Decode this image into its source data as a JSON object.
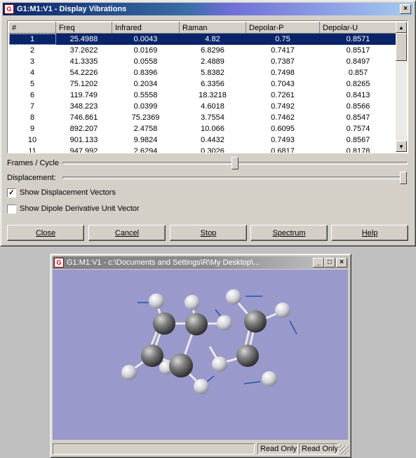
{
  "dialog": {
    "title": "G1:M1:V1 - Display Vibrations",
    "close_glyph": "×",
    "table": {
      "columns": [
        "#",
        "Freq",
        "Infrared",
        "Raman",
        "Depolar-P",
        "Depolar-U"
      ],
      "rows": [
        [
          "1",
          "25.4988",
          "0.0043",
          "4.82",
          "0.75",
          "0.8571"
        ],
        [
          "2",
          "37.2622",
          "0.0169",
          "6.8296",
          "0.7417",
          "0.8517"
        ],
        [
          "3",
          "41.3335",
          "0.0558",
          "2.4889",
          "0.7387",
          "0.8497"
        ],
        [
          "4",
          "54.2226",
          "0.8396",
          "5.8382",
          "0.7498",
          "0.857"
        ],
        [
          "5",
          "75.1202",
          "0.2034",
          "6.3356",
          "0.7043",
          "0.8265"
        ],
        [
          "6",
          "119.749",
          "0.5558",
          "18.3218",
          "0.7261",
          "0.8413"
        ],
        [
          "7",
          "348.223",
          "0.0399",
          "4.6018",
          "0.7492",
          "0.8566"
        ],
        [
          "8",
          "746.861",
          "75.2369",
          "3.7554",
          "0.7462",
          "0.8547"
        ],
        [
          "9",
          "892.207",
          "2.4758",
          "10.066",
          "0.6095",
          "0.7574"
        ],
        [
          "10",
          "901.133",
          "9.9824",
          "0.4432",
          "0.7493",
          "0.8567"
        ],
        [
          "11",
          "947.992",
          "2.6294",
          "0.3026",
          "0.6817",
          "0.8178"
        ]
      ],
      "selected_row": 1
    },
    "frames_cycle_label": "Frames / Cycle",
    "displacement_label": "Displacement:",
    "show_displacement_vectors": {
      "label": "Show Displacement Vectors",
      "checked": true
    },
    "show_dipole_derivative": {
      "label": "Show Dipole Derivative Unit Vector",
      "checked": false
    },
    "buttons": {
      "close": "Close",
      "cancel": "Cancel",
      "stop": "Stop",
      "spectrum": "Spectrum",
      "help": "Help"
    }
  },
  "viewer": {
    "title": "G1:M1:V1 - c:\\Documents and Settings\\R\\My Desktop\\...",
    "minimize_glyph": "_",
    "maximize_glyph": "□",
    "close_glyph": "×",
    "status_readonly_1": "Read Only",
    "status_readonly_2": "Read Only",
    "background_color": "#9999cc"
  },
  "colors": {
    "title_gradient_start": "#0a246a",
    "title_gradient_end": "#a6caf0",
    "selection": "#0a246a",
    "vector": "#2255aa"
  }
}
